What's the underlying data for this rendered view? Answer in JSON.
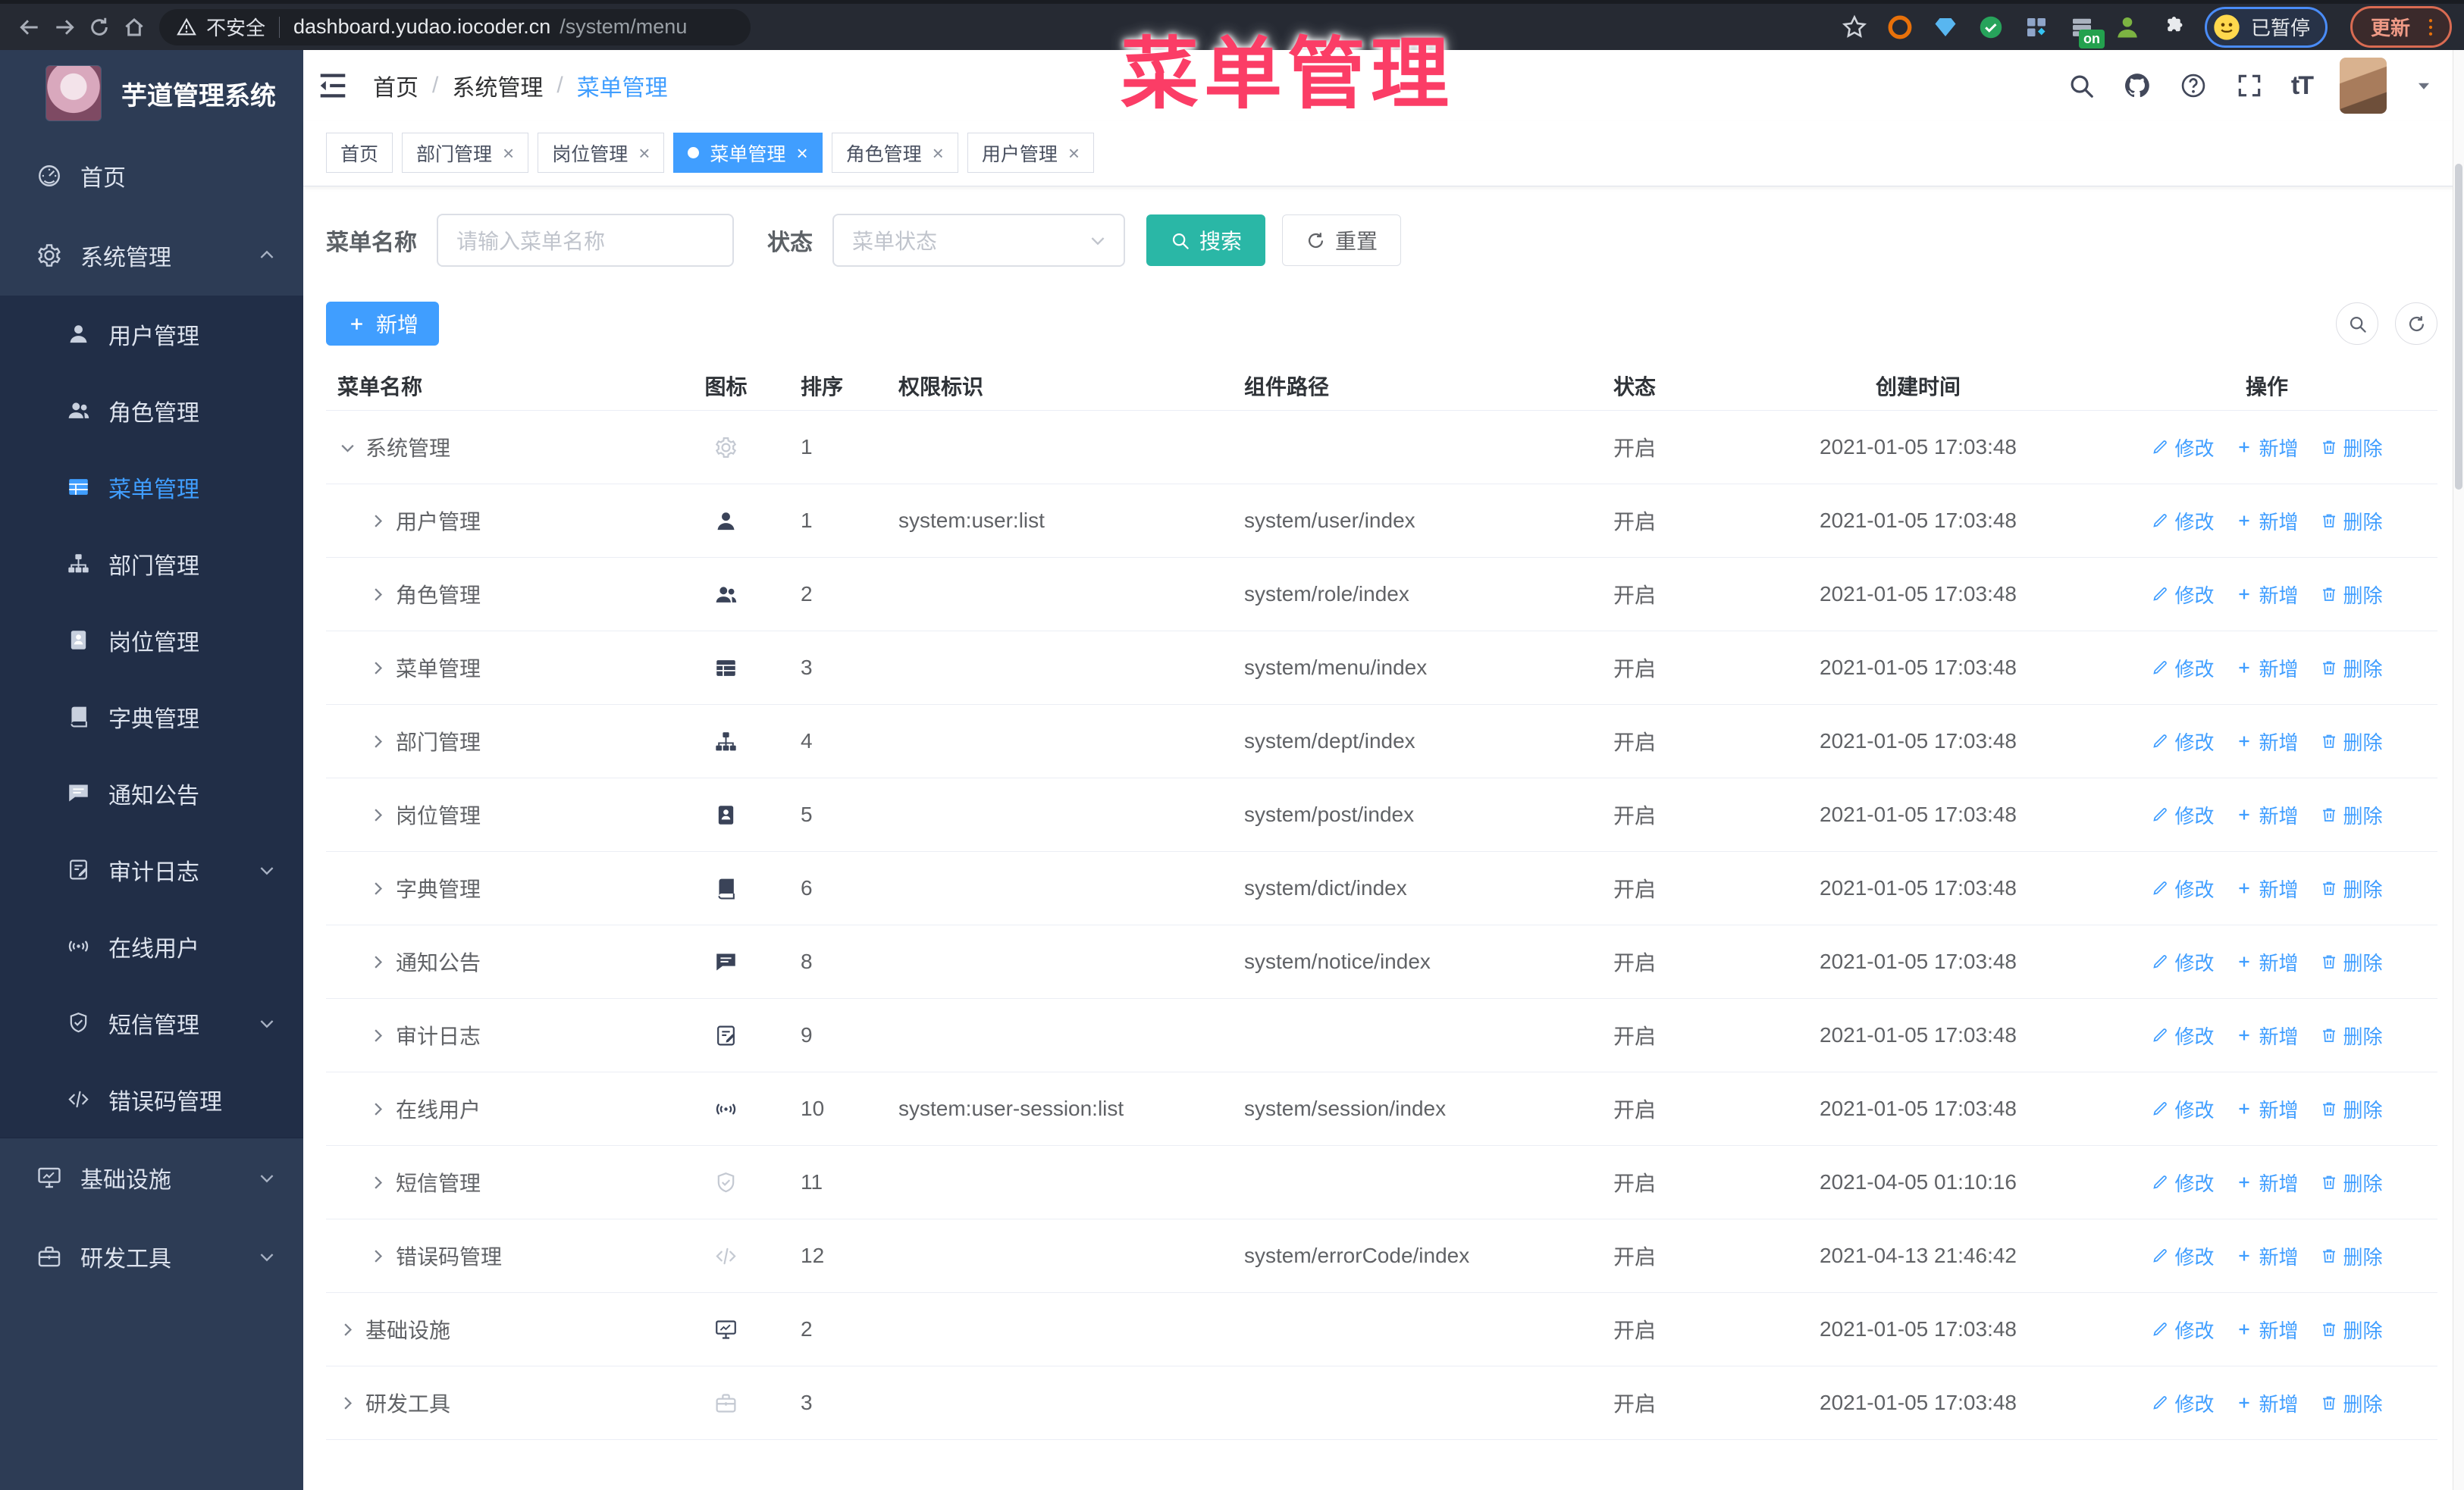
{
  "colors": {
    "primary": "#409eff",
    "link": "#409eff",
    "teal": "#2ab7a6",
    "overlay": "#fb3d66",
    "sidebar_bg": "#2d3c55",
    "submenu_bg": "#212e47"
  },
  "browser": {
    "security_label": "不安全",
    "url_host": "dashboard.yudao.iocoder.cn",
    "url_path": "/system/menu",
    "extension_badge": "on",
    "profile_status": "已暂停",
    "update_label": "更新"
  },
  "overlay_title": "菜单管理",
  "sidebar": {
    "logo_title": "芋道管理系统",
    "items": [
      {
        "label": "首页",
        "icon": "dashboard-icon",
        "type": "root"
      },
      {
        "label": "系统管理",
        "icon": "gear-icon",
        "type": "group",
        "chevron": "up"
      },
      {
        "label": "用户管理",
        "icon": "user-icon",
        "type": "sub"
      },
      {
        "label": "角色管理",
        "icon": "users-icon",
        "type": "sub"
      },
      {
        "label": "菜单管理",
        "icon": "menu-list-icon",
        "type": "sub",
        "active": true
      },
      {
        "label": "部门管理",
        "icon": "tree-icon",
        "type": "sub"
      },
      {
        "label": "岗位管理",
        "icon": "badge-icon",
        "type": "sub"
      },
      {
        "label": "字典管理",
        "icon": "dict-icon",
        "type": "sub"
      },
      {
        "label": "通知公告",
        "icon": "notice-icon",
        "type": "sub"
      },
      {
        "label": "审计日志",
        "icon": "log-icon",
        "type": "sub",
        "chevron": "down"
      },
      {
        "label": "在线用户",
        "icon": "online-icon",
        "type": "sub"
      },
      {
        "label": "短信管理",
        "icon": "shield-icon",
        "type": "sub",
        "chevron": "down"
      },
      {
        "label": "错误码管理",
        "icon": "code-icon",
        "type": "sub"
      },
      {
        "label": "基础设施",
        "icon": "monitor-icon",
        "type": "root",
        "chevron": "down"
      },
      {
        "label": "研发工具",
        "icon": "briefcase-icon",
        "type": "root",
        "chevron": "down"
      }
    ]
  },
  "header": {
    "breadcrumb": [
      "首页",
      "系统管理",
      "菜单管理"
    ],
    "separator": "/"
  },
  "tabs": [
    {
      "label": "首页"
    },
    {
      "label": "部门管理",
      "closable": true
    },
    {
      "label": "岗位管理",
      "closable": true
    },
    {
      "label": "菜单管理",
      "closable": true,
      "active": true
    },
    {
      "label": "角色管理",
      "closable": true
    },
    {
      "label": "用户管理",
      "closable": true
    }
  ],
  "filters": {
    "name_label": "菜单名称",
    "name_placeholder": "请输入菜单名称",
    "status_label": "状态",
    "status_placeholder": "菜单状态",
    "search_label": "搜索",
    "reset_label": "重置"
  },
  "toolbar": {
    "add_label": "新增"
  },
  "table": {
    "columns": [
      "菜单名称",
      "图标",
      "排序",
      "权限标识",
      "组件路径",
      "状态",
      "创建时间",
      "操作"
    ],
    "actions": [
      "修改",
      "新增",
      "删除"
    ],
    "rows": [
      {
        "name": "系统管理",
        "level": 0,
        "arrow": "down",
        "icon": "gear-icon",
        "muted": true,
        "sort": "1",
        "perm": "",
        "path": "",
        "status": "开启",
        "created": "2021-01-05 17:03:48"
      },
      {
        "name": "用户管理",
        "level": 1,
        "arrow": "right",
        "icon": "user-icon",
        "muted": false,
        "sort": "1",
        "perm": "system:user:list",
        "path": "system/user/index",
        "status": "开启",
        "created": "2021-01-05 17:03:48"
      },
      {
        "name": "角色管理",
        "level": 1,
        "arrow": "right",
        "icon": "users-icon",
        "muted": false,
        "sort": "2",
        "perm": "",
        "path": "system/role/index",
        "status": "开启",
        "created": "2021-01-05 17:03:48"
      },
      {
        "name": "菜单管理",
        "level": 1,
        "arrow": "right",
        "icon": "menu-list-icon",
        "muted": false,
        "sort": "3",
        "perm": "",
        "path": "system/menu/index",
        "status": "开启",
        "created": "2021-01-05 17:03:48"
      },
      {
        "name": "部门管理",
        "level": 1,
        "arrow": "right",
        "icon": "tree-icon",
        "muted": false,
        "sort": "4",
        "perm": "",
        "path": "system/dept/index",
        "status": "开启",
        "created": "2021-01-05 17:03:48"
      },
      {
        "name": "岗位管理",
        "level": 1,
        "arrow": "right",
        "icon": "badge-icon",
        "muted": false,
        "sort": "5",
        "perm": "",
        "path": "system/post/index",
        "status": "开启",
        "created": "2021-01-05 17:03:48"
      },
      {
        "name": "字典管理",
        "level": 1,
        "arrow": "right",
        "icon": "dict-icon",
        "muted": false,
        "sort": "6",
        "perm": "",
        "path": "system/dict/index",
        "status": "开启",
        "created": "2021-01-05 17:03:48"
      },
      {
        "name": "通知公告",
        "level": 1,
        "arrow": "right",
        "icon": "notice-icon",
        "muted": false,
        "sort": "8",
        "perm": "",
        "path": "system/notice/index",
        "status": "开启",
        "created": "2021-01-05 17:03:48"
      },
      {
        "name": "审计日志",
        "level": 1,
        "arrow": "right",
        "icon": "log-icon",
        "muted": false,
        "sort": "9",
        "perm": "",
        "path": "",
        "status": "开启",
        "created": "2021-01-05 17:03:48"
      },
      {
        "name": "在线用户",
        "level": 1,
        "arrow": "right",
        "icon": "online-icon",
        "muted": false,
        "sort": "10",
        "perm": "system:user-session:list",
        "path": "system/session/index",
        "status": "开启",
        "created": "2021-01-05 17:03:48"
      },
      {
        "name": "短信管理",
        "level": 1,
        "arrow": "right",
        "icon": "shield-icon",
        "muted": true,
        "sort": "11",
        "perm": "",
        "path": "",
        "status": "开启",
        "created": "2021-04-05 01:10:16"
      },
      {
        "name": "错误码管理",
        "level": 1,
        "arrow": "right",
        "icon": "code-icon",
        "muted": true,
        "sort": "12",
        "perm": "",
        "path": "system/errorCode/index",
        "status": "开启",
        "created": "2021-04-13 21:46:42"
      },
      {
        "name": "基础设施",
        "level": 0,
        "arrow": "right",
        "icon": "monitor-icon",
        "muted": false,
        "sort": "2",
        "perm": "",
        "path": "",
        "status": "开启",
        "created": "2021-01-05 17:03:48"
      },
      {
        "name": "研发工具",
        "level": 0,
        "arrow": "right",
        "icon": "briefcase-icon",
        "muted": true,
        "sort": "3",
        "perm": "",
        "path": "",
        "status": "开启",
        "created": "2021-01-05 17:03:48"
      }
    ]
  }
}
